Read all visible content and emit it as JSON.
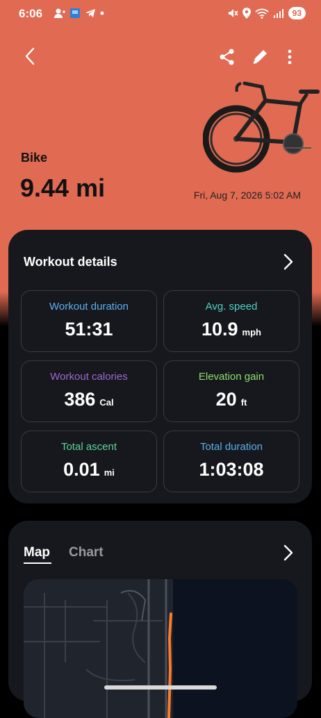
{
  "status_bar": {
    "time": "6:06",
    "battery": "93"
  },
  "header": {
    "sport": "Bike",
    "distance": "9.44 mi",
    "date": "Fri, Aug 7, 2026 5:02 AM"
  },
  "workout_details": {
    "title": "Workout details",
    "tiles": [
      {
        "label": "Workout duration",
        "value": "51:31",
        "unit": "",
        "color": "#5ab0ef"
      },
      {
        "label": "Avg. speed",
        "value": "10.9",
        "unit": "mph",
        "color": "#4fd1c5"
      },
      {
        "label": "Workout calories",
        "value": "386",
        "unit": "Cal",
        "color": "#9b6ad4"
      },
      {
        "label": "Elevation gain",
        "value": "20",
        "unit": "ft",
        "color": "#8ee06e"
      },
      {
        "label": "Total ascent",
        "value": "0.01",
        "unit": "mi",
        "color": "#5fd39a"
      },
      {
        "label": "Total duration",
        "value": "1:03:08",
        "unit": "",
        "color": "#5ab0ef"
      }
    ]
  },
  "map_card": {
    "tabs": [
      "Map",
      "Chart"
    ],
    "active_tab": "Map"
  },
  "colors": {
    "accent": "#e06a52",
    "card": "#17181d",
    "route": "#ff7a2a"
  }
}
